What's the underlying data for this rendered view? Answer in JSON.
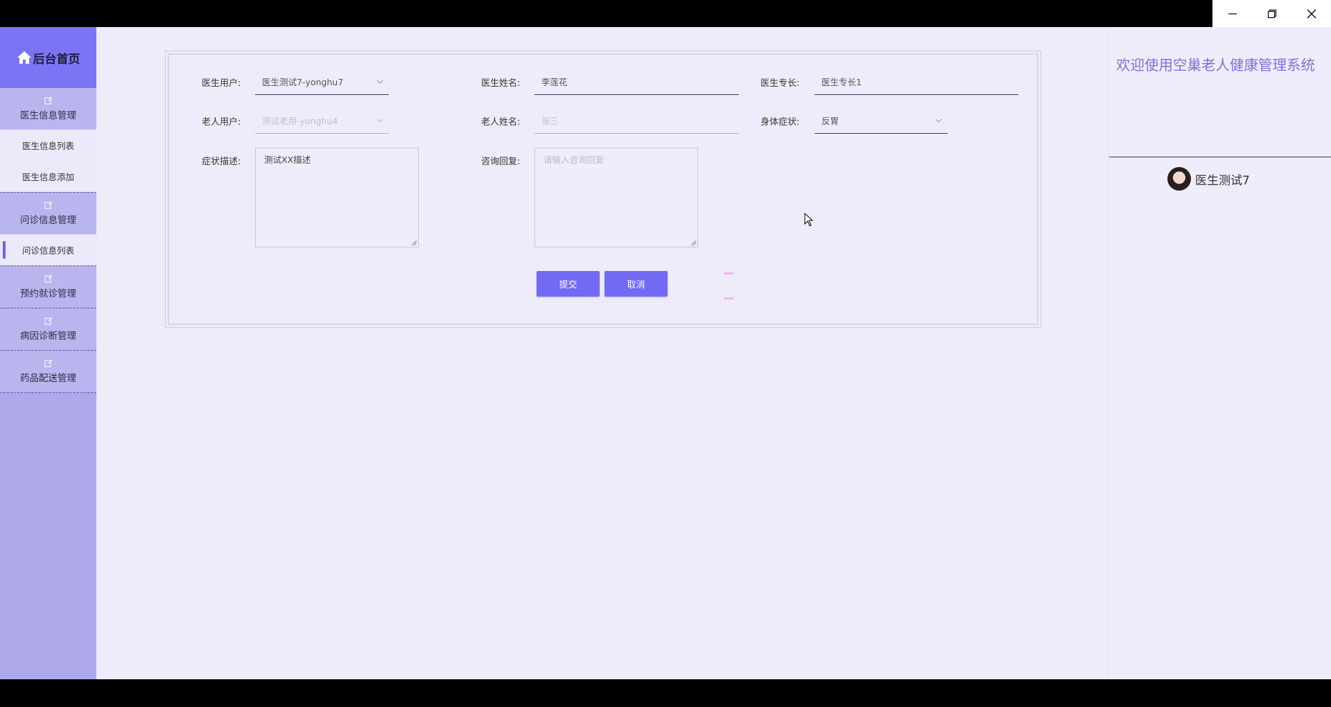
{
  "window": {
    "minimize": "minimize",
    "restore": "restore",
    "close": "close"
  },
  "sidebar": {
    "home_label": "后台首页",
    "groups": [
      {
        "title": "医生信息管理",
        "items": [
          "医生信息列表",
          "医生信息添加"
        ]
      },
      {
        "title": "问诊信息管理",
        "items": [
          "问诊信息列表"
        ]
      },
      {
        "title": "预约就诊管理",
        "items": []
      },
      {
        "title": "病因诊断管理",
        "items": []
      },
      {
        "title": "药品配送管理",
        "items": []
      }
    ],
    "active_item": "问诊信息列表"
  },
  "form": {
    "doctor_user_label": "医生用户:",
    "doctor_user_value": "医生测试7-yonghu7",
    "doctor_name_label": "医生姓名:",
    "doctor_name_value": "李莲花",
    "doctor_specialty_label": "医生专长:",
    "doctor_specialty_value": "医生专长1",
    "elder_user_label": "老人用户:",
    "elder_user_value": "测试老用-yonghu4",
    "elder_name_label": "老人姓名:",
    "elder_name_value": "张三",
    "symptom_label": "身体症状:",
    "symptom_value": "反胃",
    "symptom_desc_label": "症状描述:",
    "symptom_desc_value": "测试XX描述",
    "reply_label": "咨询回复:",
    "reply_placeholder": "请输入咨询回复",
    "submit_label": "提交",
    "cancel_label": "取消"
  },
  "right_panel": {
    "welcome": "欢迎使用空巢老人健康管理系统",
    "username": "医生测试7"
  },
  "colors": {
    "accent": "#736af3",
    "sidebar": "#aeaaea",
    "background": "#eeebfb"
  }
}
